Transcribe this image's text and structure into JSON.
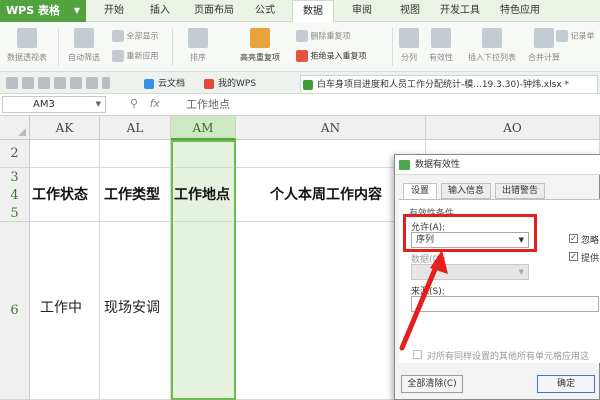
{
  "app": {
    "logo": "WPS 表格",
    "menu_tabs": [
      "开始",
      "插入",
      "页面布局",
      "公式",
      "数据",
      "审阅",
      "视图",
      "开发工具",
      "特色应用"
    ],
    "active_menu": "数据"
  },
  "ribbon": {
    "pivot": "数据透视表",
    "auto_filter": "自动筛选",
    "show_all": "全部显示",
    "reapply": "重新应用",
    "sort": "排序",
    "highlight_dup": "高亮重复项",
    "delete_dup": "删除重复项",
    "reject_dup": "拒绝录入重复项",
    "split": "分列",
    "validity": "有效性",
    "dropdown": "插入下拉列表",
    "merge_calc": "合并计算",
    "record": "记录单"
  },
  "doc_tabs": {
    "cloud": "云文档",
    "mywps": "我的WPS",
    "file": "白车身项目进度和人员工作分配统计-模...19.3.30)-钟炜.xlsx *"
  },
  "formula_bar": {
    "cell_ref": "AM3",
    "fx": "fx",
    "value": "工作地点"
  },
  "sheet": {
    "columns": [
      "AK",
      "AL",
      "AM",
      "AN",
      "AO"
    ],
    "rows": [
      "2",
      "3",
      "4",
      "5",
      "6"
    ],
    "header_row": [
      "工作状态",
      "工作类型",
      "工作地点",
      "个人本周工作内容"
    ],
    "data_row": [
      "工作中",
      "现场安调"
    ]
  },
  "dialog": {
    "title": "数据有效性",
    "tabs": [
      "设置",
      "输入信息",
      "出错警告"
    ],
    "section": "有效性条件",
    "allow_label": "允许(A):",
    "allow_value": "序列",
    "data_label": "数据(D):",
    "source_label": "来源(S):",
    "ignore_blank": "忽略",
    "dropdown_opt": "提供",
    "apply_all": "对所有同样设置的其他所有单元格应用这",
    "clear_all": "全部清除(C)",
    "ok": "确定"
  },
  "colors": {
    "brand": "#53a240",
    "selection": "#e5f2de",
    "annotation": "#e3201b"
  }
}
